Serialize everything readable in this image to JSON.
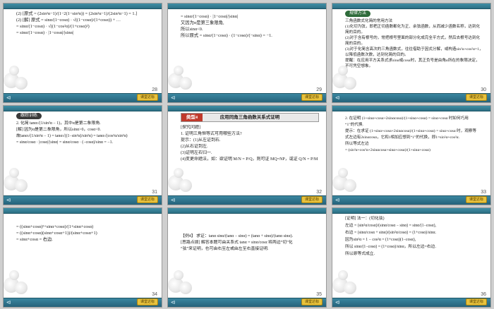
{
  "slides": [
    {
      "number": "28",
      "lines": [
        "(2) [原式 = (2sin²α−1)/(1−2(1−sin²α)) = (2sin²α−1)/(2sin²α−1) = 1.]",
        "",
        "(2) [解] 原式 = sinα/(1−cosα) · √((1−cosα)/(1+cosα)) + …",
        "",
        "= sinα/(1−cosα) · √((1−cos²α)/(1+cosα)²)",
        "",
        "= sinα/(1−cosα) · |1−cosα|/|sinα|"
      ]
    },
    {
      "number": "29",
      "lines": [
        "= sinα/(1−cosα) · |1−cosα|/|sinα|",
        "",
        "又因为α是第三象限角,",
        "所以sinα<0.",
        "",
        "所以原式 = sinα/(1−cosα) · (1−cosα)/(−sinα) = −1."
      ]
    },
    {
      "number": "30",
      "tag": "规律方法",
      "lines": [
        "三角函数式化简的常用方法",
        "(1)化切为弦，即把正切函数都化为正、余弦函数，从而减少函数名称，达到化简的目的。",
        "(2)对于含有根号的，常把根号里面的部分化成完全平方式，然后去根号达到化简的目的。",
        "(3)对于化简含高次的三角函数式，往往借助于因式分解，或构造sin²α+cos²α=1，以降低函数次数，达到化简的目的。",
        "提醒：在应用平方关系式求sinα或cosα时，其正负号是由角α所在的象限决定，不可凭空想象。"
      ]
    },
    {
      "number": "31",
      "tag": "跟踪训练",
      "lines": [
        "2. 化简 tanα√(1/sin²α − 1)，其中α是第二象限角.",
        "",
        "[解] 因为α是第二象限角，所以sinα>0，cosα<0.",
        "",
        "故tanα√(1/sin²α − 1) = tanα√((1−sin²α)/sin²α) = tanα√(cos²α/sin²α)",
        "",
        "= sinα/cosα · |cosα|/|sinα| = sinα/cosα · (−cosα)/sinα = −1."
      ]
    },
    {
      "number": "32",
      "header_tag": "类型4",
      "header_title": "应用同角三角函数关系式证明",
      "lines": [
        "[探究问题]",
        "1. 证明三角恒等式可用哪些方法?",
        "提示：(1)从左证到右.",
        "(2)从右证到左.",
        "(3)证明左右归一.",
        "(4)变更命题法，如：欲证明 M/N = P/Q，则可证 MQ=NP，或证 Q/N = P/M 等."
      ]
    },
    {
      "number": "33",
      "lines": [
        "2. 在证明 (1+sinα+cosα+2sinαcosα)/(1+sinα+cosα) = sinα+cosα 时如何巧用",
        "“1”的代换.",
        "提示：在求证 (1+sinα+cosα+2sinαcosα)/(1+sinα+cosα) = sinα+cosα 时，观察等",
        "式左边有2sinαcosα，它和1相加应想到“1”的代换，即1=sin²α+cos²α.",
        "所以等式左边",
        "= (sin²α+cos²α+2sinαcosα+sinα+cosα)/(1+sinα+cosα)"
      ]
    },
    {
      "number": "34",
      "lines": [
        "= ((sinα+cosα)²+sinα+cosα)/(1+sinα+cosα)",
        "",
        "= ((sinα+cosα)(sinα+cosα+1))/(sinα+cosα+1)",
        "",
        "= sinα+cosα = 右边."
      ]
    },
    {
      "number": "35",
      "lines": [
        "【例4】 求证：tanα sinα/(tanα − sinα) = (tanα + sinα)/(tanα sinα).",
        "",
        "[思路点拨] 解答本题可由关系式 tanα = sinα/cosα 将两边“切”化",
        "“弦”来证明，也可由右至左或由左至右直接证明."
      ]
    },
    {
      "number": "36",
      "lines": [
        "[证明] 法一：(切化弦)",
        "左边 = (sin²α/cosα)/(sinα/cosα − sinα) = sinα/(1−cosα),",
        "右边 = (sinα/cosα + sinα)/(sin²α/cosα) = (1+cosα)/sinα.",
        "因为sin²α = 1 − cos²α = (1+cosα)(1−cosα),",
        "所以 sinα/(1−cosα) = (1+cosα)/sinα，所以左边=右边.",
        "所以原等式成立."
      ]
    }
  ],
  "badge_label": "课堂达标",
  "nav_glyph": "⊲"
}
